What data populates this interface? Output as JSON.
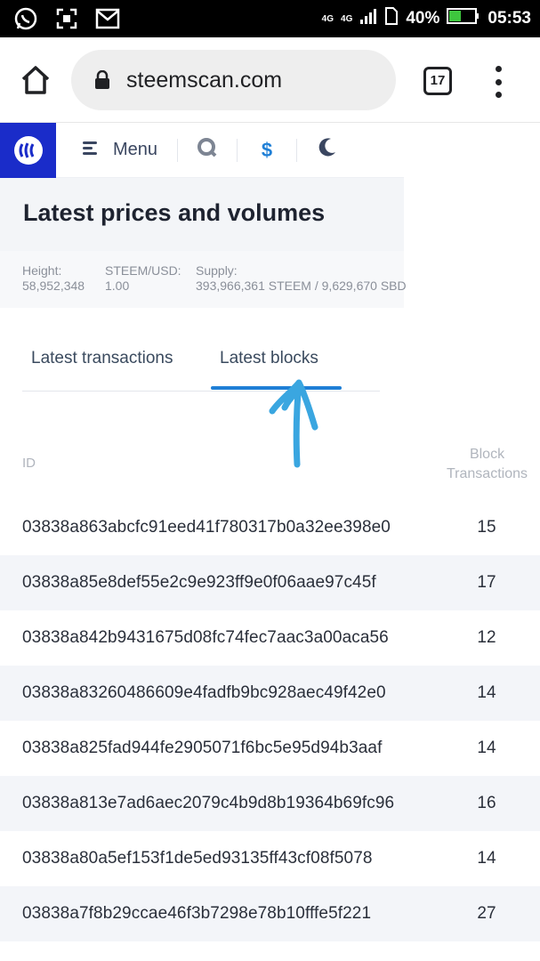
{
  "statusbar": {
    "net1": "4G",
    "net2": "4G",
    "battery": "40%",
    "time": "05:53"
  },
  "browser": {
    "url": "steemscan.com",
    "tab_count": "17"
  },
  "nav": {
    "menu_label": "Menu",
    "currency_symbol": "$"
  },
  "header": {
    "title": "Latest prices and volumes"
  },
  "stats": {
    "height_label": "Height:",
    "height_value": "58,952,348",
    "price_label": "STEEM/USD:",
    "price_value": "1.00",
    "supply_label": "Supply:",
    "supply_value": "393,966,361 STEEM / 9,629,670 SBD"
  },
  "tabs": {
    "transactions": "Latest transactions",
    "blocks": "Latest blocks",
    "active": "blocks"
  },
  "table": {
    "col_id": "ID",
    "col_block_1": "Block",
    "col_block_2": "Transactions",
    "rows": [
      {
        "id": "03838a863abcfc91eed41f780317b0a32ee398e0",
        "tx": "15"
      },
      {
        "id": "03838a85e8def55e2c9e923ff9e0f06aae97c45f",
        "tx": "17"
      },
      {
        "id": "03838a842b9431675d08fc74fec7aac3a00aca56",
        "tx": "12"
      },
      {
        "id": "03838a83260486609e4fadfb9bc928aec49f42e0",
        "tx": "14"
      },
      {
        "id": "03838a825fad944fe2905071f6bc5e95d94b3aaf",
        "tx": "14"
      },
      {
        "id": "03838a813e7ad6aec2079c4b9d8b19364b69fc96",
        "tx": "16"
      },
      {
        "id": "03838a80a5ef153f1de5ed93135ff43cf08f5078",
        "tx": "14"
      },
      {
        "id": "03838a7f8b29ccae46f3b7298e78b10fffe5f221",
        "tx": "27"
      }
    ]
  },
  "colors": {
    "brand": "#1a2cc9",
    "accent": "#1f7fd6",
    "annotation": "#3aa6e0"
  }
}
